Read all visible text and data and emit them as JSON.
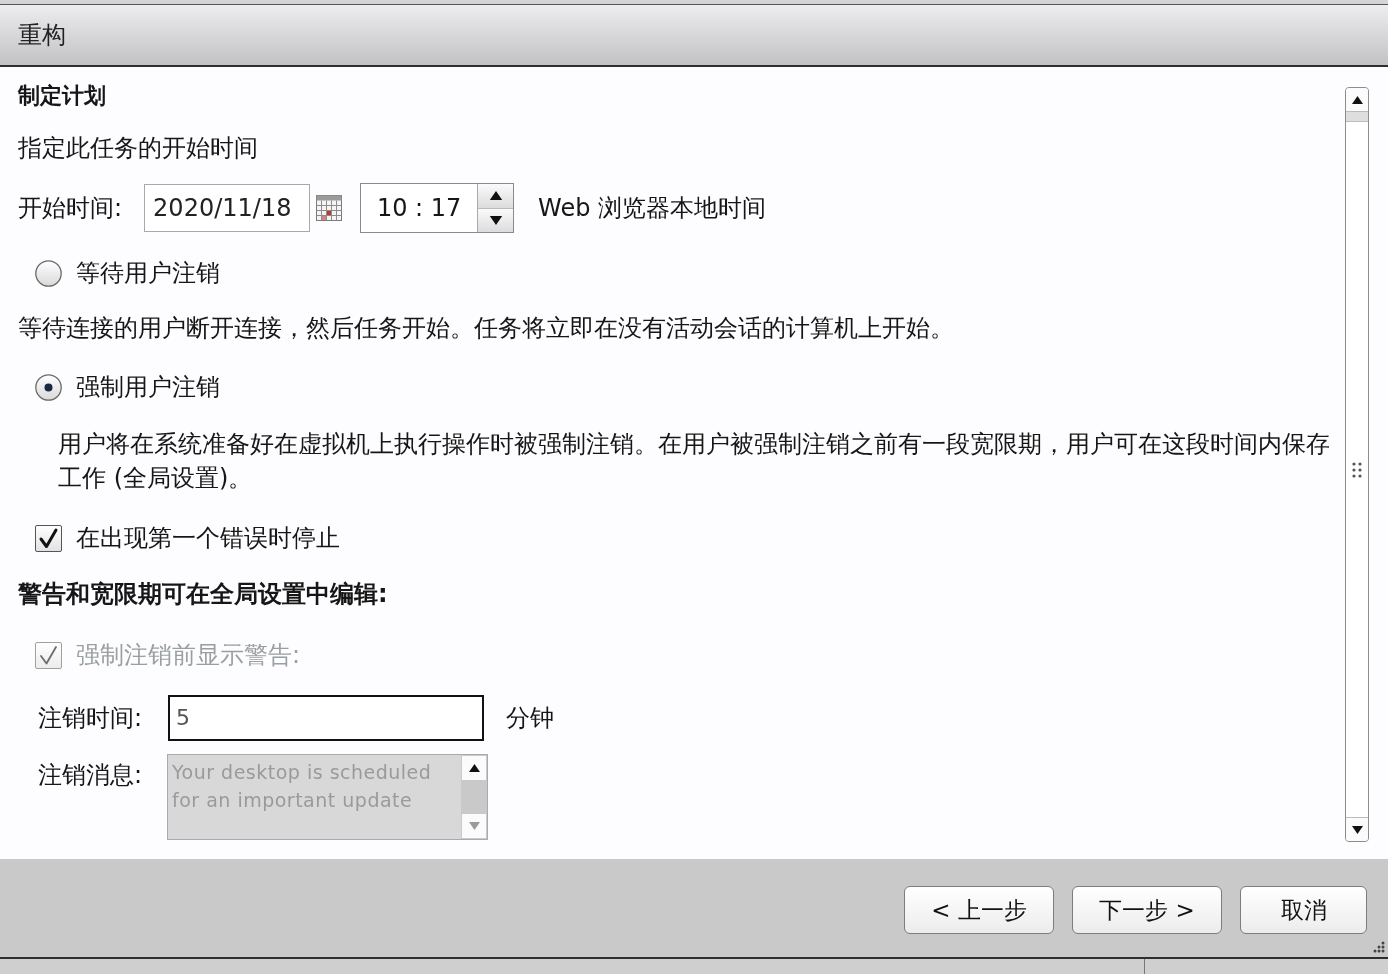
{
  "window": {
    "title": "重构"
  },
  "schedule": {
    "heading": "制定计划",
    "caption": "指定此任务的开始时间",
    "start_label": "开始时间:",
    "date": "2020/11/18",
    "time": "10 : 17",
    "timezone": "Web 浏览器本地时间"
  },
  "logoff_options": [
    {
      "label": "等待用户注销",
      "selected": false,
      "description": "等待连接的用户断开连接，然后任务开始。任务将立即在没有活动会话的计算机上开始。"
    },
    {
      "label": "强制用户注销",
      "selected": true,
      "description": "用户将在系统准备好在虚拟机上执行操作时被强制注销。在用户被强制注销之前有一段宽限期，用户可在这段时间内保存工作 (全局设置)。"
    }
  ],
  "stop_on_error": {
    "label": "在出现第一个错误时停止",
    "checked": true
  },
  "global_settings": {
    "heading": "警告和宽限期可在全局设置中编辑:",
    "show_warning": {
      "label": "强制注销前显示警告:",
      "checked": true,
      "disabled": true
    },
    "logoff_time": {
      "label": "注销时间:",
      "value": "5",
      "unit": "分钟"
    },
    "logoff_message": {
      "label": "注销消息:",
      "value": "Your desktop is scheduled for an important update",
      "disabled": true
    }
  },
  "buttons": [
    {
      "label": "< 上一步"
    },
    {
      "label": "下一步 >"
    },
    {
      "label": "取消"
    }
  ]
}
